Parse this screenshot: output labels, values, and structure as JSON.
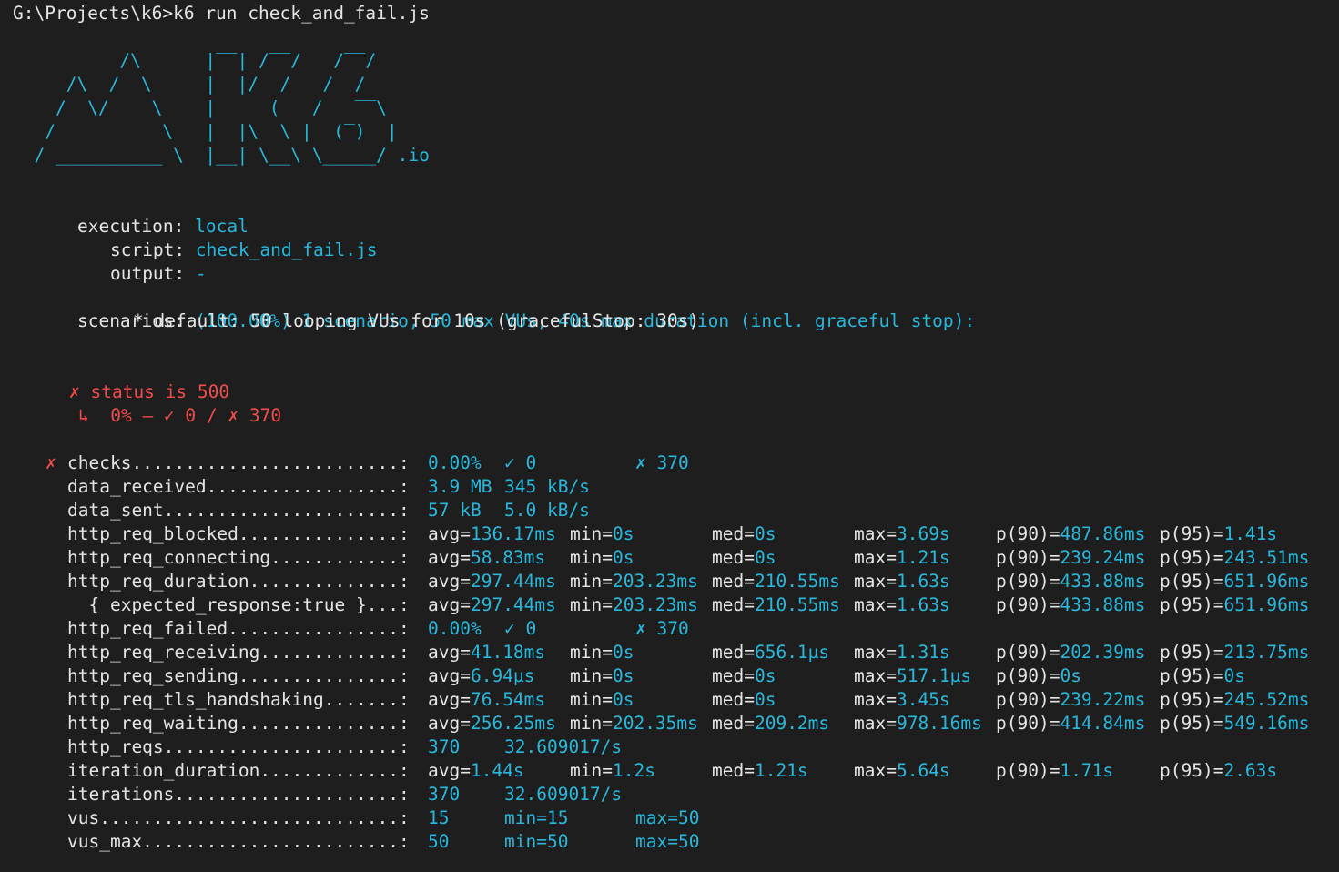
{
  "prompt": "G:\\Projects\\k6>k6 run check_and_fail.js",
  "logo": {
    "lines": [
      "          /\\      |‾‾| /‾‾/   /‾‾/   ",
      "     /\\  /  \\     |  |/  /   /  /    ",
      "    /  \\/    \\    |     (   /   ‾‾\\  ",
      "   /          \\   |  |\\  \\ |  (‾)  | ",
      "  / __________ \\  |__| \\__\\ \\_____/ .io"
    ]
  },
  "info": {
    "execution_label": "execution:",
    "execution_value": "local",
    "script_label": "script:",
    "script_value": "check_and_fail.js",
    "output_label": "output:",
    "output_value": "-",
    "scenarios_label": "scenarios:",
    "scenarios_value": "(100.00%) 1 scenario, 50 max VUs, 40s max duration (incl. graceful stop):",
    "scenario_detail": "* default: 50 looping VUs for 10s (gracefulStop: 30s)"
  },
  "check": {
    "name": "✗ status is 500",
    "detail": "↳  0% — ✓ 0 / ✗ 370"
  },
  "metrics": [
    {
      "mark": "✗",
      "name": "checks.........................:",
      "cols": [
        "0.00%",
        "✓ 0",
        "",
        "✗ 370"
      ]
    },
    {
      "mark": "",
      "name": "data_received..................:",
      "cols": [
        "3.9 MB",
        "345 kB/s"
      ]
    },
    {
      "mark": "",
      "name": "data_sent......................:",
      "cols": [
        "57 kB",
        "5.0 kB/s"
      ]
    },
    {
      "mark": "",
      "name": "http_req_blocked...............:",
      "stats": [
        [
          "avg=",
          "136.17ms"
        ],
        [
          "min=",
          "0s"
        ],
        [
          "med=",
          "0s"
        ],
        [
          "max=",
          "3.69s"
        ],
        [
          "p(90)=",
          "487.86ms"
        ],
        [
          "p(95)=",
          "1.41s"
        ]
      ]
    },
    {
      "mark": "",
      "name": "http_req_connecting............:",
      "stats": [
        [
          "avg=",
          "58.83ms"
        ],
        [
          "min=",
          "0s"
        ],
        [
          "med=",
          "0s"
        ],
        [
          "max=",
          "1.21s"
        ],
        [
          "p(90)=",
          "239.24ms"
        ],
        [
          "p(95)=",
          "243.51ms"
        ]
      ]
    },
    {
      "mark": "",
      "name": "http_req_duration..............:",
      "stats": [
        [
          "avg=",
          "297.44ms"
        ],
        [
          "min=",
          "203.23ms"
        ],
        [
          "med=",
          "210.55ms"
        ],
        [
          "max=",
          "1.63s"
        ],
        [
          "p(90)=",
          "433.88ms"
        ],
        [
          "p(95)=",
          "651.96ms"
        ]
      ]
    },
    {
      "mark": "",
      "name": "  { expected_response:true }...:",
      "stats": [
        [
          "avg=",
          "297.44ms"
        ],
        [
          "min=",
          "203.23ms"
        ],
        [
          "med=",
          "210.55ms"
        ],
        [
          "max=",
          "1.63s"
        ],
        [
          "p(90)=",
          "433.88ms"
        ],
        [
          "p(95)=",
          "651.96ms"
        ]
      ]
    },
    {
      "mark": "",
      "name": "http_req_failed................:",
      "cols": [
        "0.00%",
        "✓ 0",
        "",
        "✗ 370"
      ]
    },
    {
      "mark": "",
      "name": "http_req_receiving.............:",
      "stats": [
        [
          "avg=",
          "41.18ms"
        ],
        [
          "min=",
          "0s"
        ],
        [
          "med=",
          "656.1µs"
        ],
        [
          "max=",
          "1.31s"
        ],
        [
          "p(90)=",
          "202.39ms"
        ],
        [
          "p(95)=",
          "213.75ms"
        ]
      ]
    },
    {
      "mark": "",
      "name": "http_req_sending...............:",
      "stats": [
        [
          "avg=",
          "6.94µs"
        ],
        [
          "min=",
          "0s"
        ],
        [
          "med=",
          "0s"
        ],
        [
          "max=",
          "517.1µs"
        ],
        [
          "p(90)=",
          "0s"
        ],
        [
          "p(95)=",
          "0s"
        ]
      ]
    },
    {
      "mark": "",
      "name": "http_req_tls_handshaking.......:",
      "stats": [
        [
          "avg=",
          "76.54ms"
        ],
        [
          "min=",
          "0s"
        ],
        [
          "med=",
          "0s"
        ],
        [
          "max=",
          "3.45s"
        ],
        [
          "p(90)=",
          "239.22ms"
        ],
        [
          "p(95)=",
          "245.52ms"
        ]
      ]
    },
    {
      "mark": "",
      "name": "http_req_waiting...............:",
      "stats": [
        [
          "avg=",
          "256.25ms"
        ],
        [
          "min=",
          "202.35ms"
        ],
        [
          "med=",
          "209.2ms"
        ],
        [
          "max=",
          "978.16ms"
        ],
        [
          "p(90)=",
          "414.84ms"
        ],
        [
          "p(95)=",
          "549.16ms"
        ]
      ]
    },
    {
      "mark": "",
      "name": "http_reqs......................:",
      "cols": [
        "370",
        "32.609017/s"
      ]
    },
    {
      "mark": "",
      "name": "iteration_duration.............:",
      "stats": [
        [
          "avg=",
          "1.44s"
        ],
        [
          "min=",
          "1.2s"
        ],
        [
          "med=",
          "1.21s"
        ],
        [
          "max=",
          "5.64s"
        ],
        [
          "p(90)=",
          "1.71s"
        ],
        [
          "p(95)=",
          "2.63s"
        ]
      ]
    },
    {
      "mark": "",
      "name": "iterations.....................:",
      "cols": [
        "370",
        "32.609017/s"
      ]
    },
    {
      "mark": "",
      "name": "vus............................:",
      "cols": [
        "15",
        "min=15",
        "max=50"
      ]
    },
    {
      "mark": "",
      "name": "vus_max........................:",
      "cols": [
        "50",
        "min=50",
        "max=50"
      ]
    }
  ],
  "colors": {
    "background": "#1e1e1e",
    "text": "#cccccc",
    "accent": "#29b8db",
    "error": "#f14c4c"
  }
}
